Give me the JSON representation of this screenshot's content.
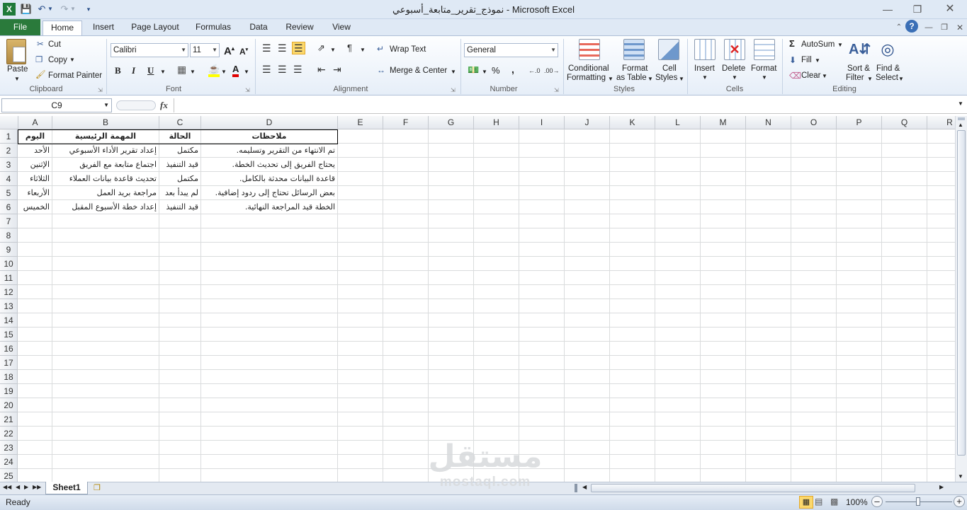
{
  "window": {
    "title": "نموذج_تقرير_متابعة_أسبوعي  -  Microsoft Excel",
    "qat": [
      "save-icon",
      "undo-icon",
      "redo-icon",
      "customize-icon"
    ],
    "controls": [
      "minimize-icon",
      "restore-icon",
      "close-icon"
    ]
  },
  "tabs": {
    "file": "File",
    "home": "Home",
    "insert": "Insert",
    "page_layout": "Page Layout",
    "formulas": "Formulas",
    "data": "Data",
    "review": "Review",
    "view": "View"
  },
  "ribbon": {
    "clipboard": {
      "paste": "Paste",
      "cut": "Cut",
      "copy": "Copy",
      "format_painter": "Format Painter",
      "label": "Clipboard"
    },
    "font": {
      "name": "Calibri",
      "size": "11",
      "bold": "B",
      "italic": "I",
      "underline": "U",
      "font_color_letter": "A",
      "label": "Font"
    },
    "alignment": {
      "wrap": "Wrap Text",
      "merge": "Merge & Center",
      "label": "Alignment"
    },
    "number": {
      "format": "General",
      "percent": "%",
      "comma": ",",
      "label": "Number"
    },
    "styles": {
      "conditional_line1": "Conditional",
      "conditional_line2": "Formatting",
      "format_table_line1": "Format",
      "format_table_line2": "as Table",
      "cell_styles_line1": "Cell",
      "cell_styles_line2": "Styles",
      "label": "Styles"
    },
    "cells": {
      "insert": "Insert",
      "delete": "Delete",
      "format": "Format",
      "label": "Cells"
    },
    "editing": {
      "autosum": "AutoSum",
      "fill": "Fill",
      "clear": "Clear",
      "sort_line1": "Sort &",
      "sort_line2": "Filter",
      "find_line1": "Find &",
      "find_line2": "Select",
      "label": "Editing"
    }
  },
  "formula_bar": {
    "name_box": "C9",
    "fx": "fx",
    "value": ""
  },
  "grid": {
    "columns": [
      "A",
      "B",
      "C",
      "D",
      "E",
      "F",
      "G",
      "H",
      "I",
      "J",
      "K",
      "L",
      "M",
      "N",
      "O",
      "P",
      "Q",
      "R"
    ],
    "rows": [
      "1",
      "2",
      "3",
      "4",
      "5",
      "6",
      "7",
      "8",
      "9",
      "10",
      "11",
      "12",
      "13",
      "14",
      "15",
      "16",
      "17",
      "18",
      "19",
      "20",
      "21",
      "22",
      "23",
      "24",
      "25"
    ],
    "header_row": {
      "a": "اليوم",
      "b": "المهمة الرئيسية",
      "c": "الحالة",
      "d": "ملاحظات"
    },
    "data_rows": [
      {
        "a": "الأحد",
        "b": "إعداد تقرير الأداء الأسبوعي",
        "c": "مكتمل",
        "d": "تم الانتهاء من التقرير وتسليمه."
      },
      {
        "a": "الإثنين",
        "b": "اجتماع متابعة مع الفريق",
        "c": "قيد التنفيذ",
        "d": "يحتاج الفريق إلى تحديث الخطة."
      },
      {
        "a": "الثلاثاء",
        "b": "تحديث قاعدة بيانات العملاء",
        "c": "مكتمل",
        "d": "قاعدة البيانات محدثة بالكامل."
      },
      {
        "a": "الأربعاء",
        "b": "مراجعة بريد العمل",
        "c": "لم يبدأ بعد",
        "d": "بعض الرسائل تحتاج إلى ردود إضافية."
      },
      {
        "a": "الخميس",
        "b": "إعداد خطة الأسبوع المقبل",
        "c": "قيد التنفيذ",
        "d": "الخطة قيد المراجعة النهائية."
      }
    ]
  },
  "sheets": {
    "active": "Sheet1"
  },
  "status": {
    "ready": "Ready",
    "zoom": "100%"
  },
  "watermark": {
    "arabic": "مستقل",
    "latin": "mostaql.com"
  }
}
